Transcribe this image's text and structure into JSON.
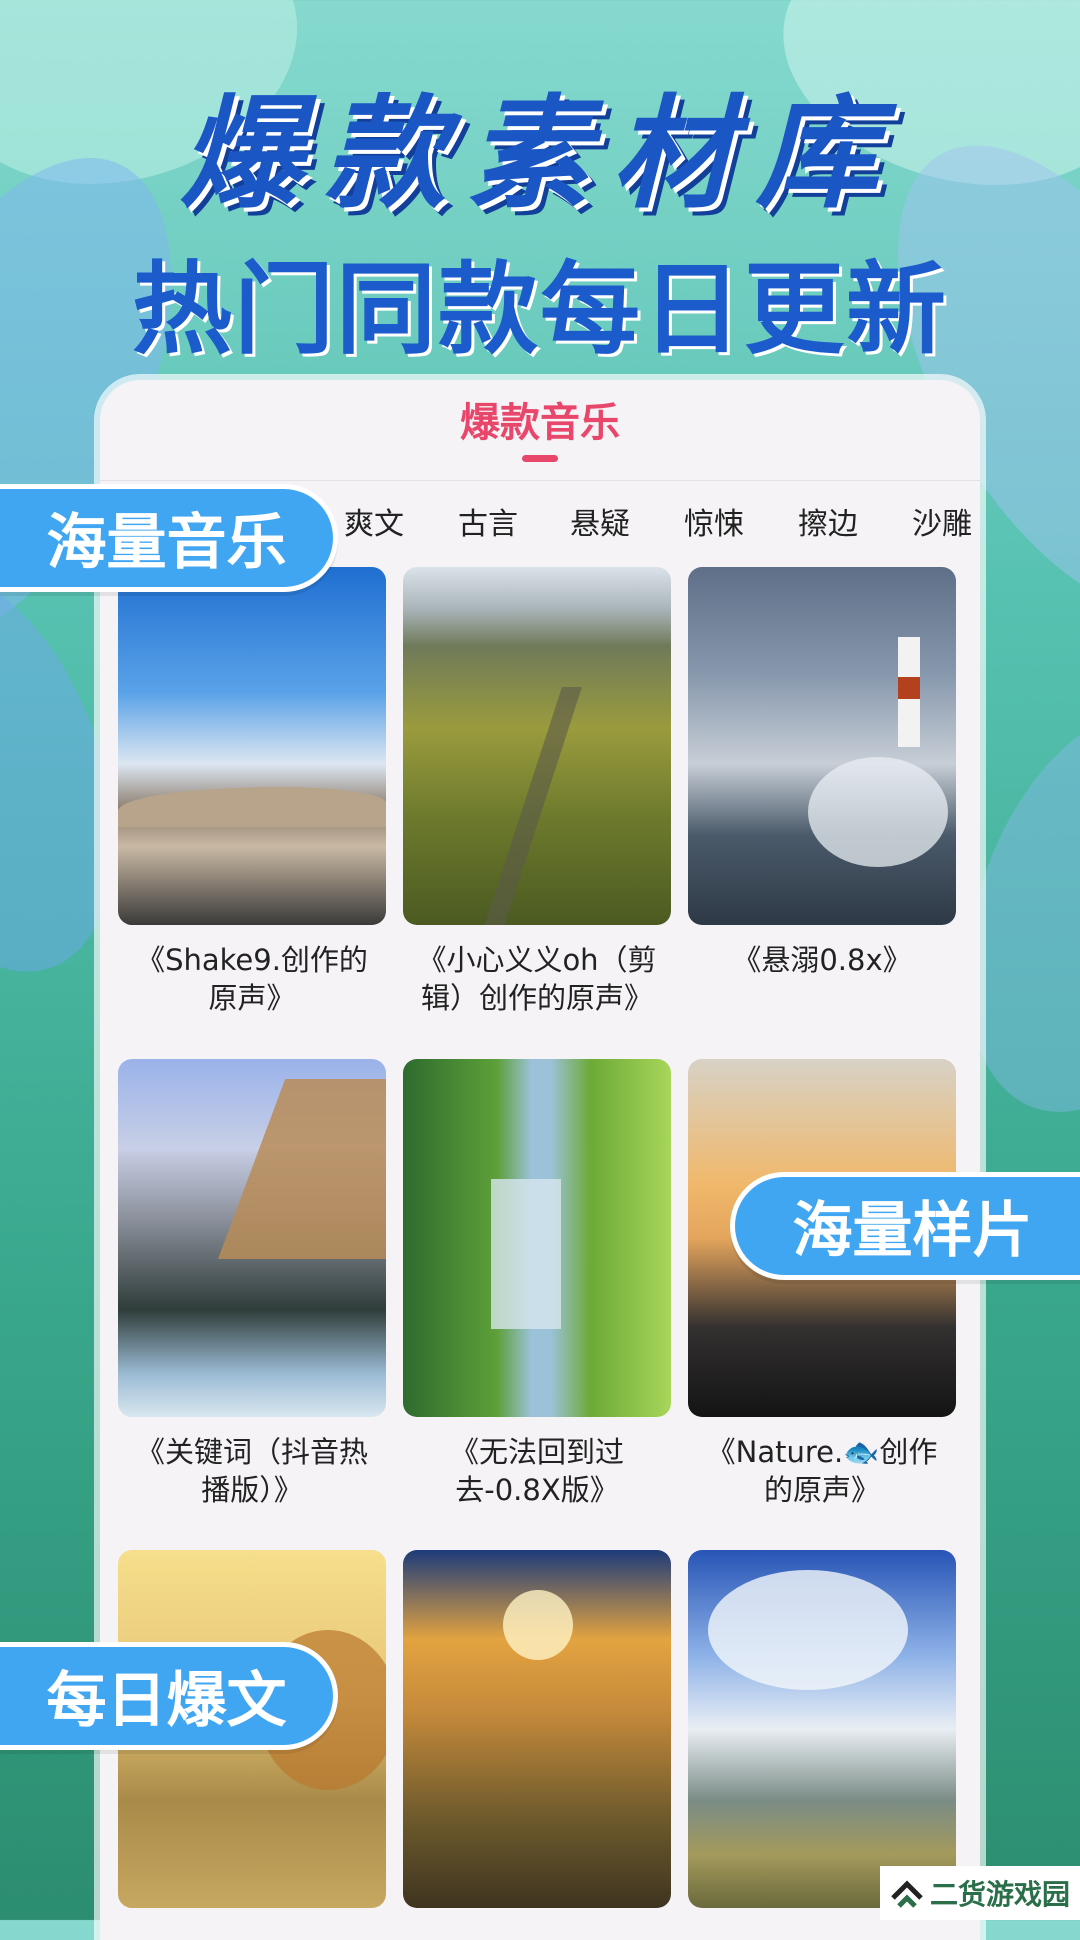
{
  "hero": {
    "title": "爆款素材库",
    "subtitle": "热门同款每日更新"
  },
  "phone": {
    "title": "爆款音乐",
    "tabs": [
      "爽文",
      "古言",
      "悬疑",
      "惊悚",
      "擦边",
      "沙雕"
    ],
    "cards": [
      {
        "caption_line1": "《Shake9.创作的",
        "caption_line2": "原声》"
      },
      {
        "caption_line1": "《小心义义oh（剪",
        "caption_line2": "辑）创作的原声》"
      },
      {
        "caption_line1": "《悬溺0.8x》",
        "caption_line2": ""
      },
      {
        "caption_line1": "《关键词（抖音热",
        "caption_line2": "播版）》"
      },
      {
        "caption_line1": "《无法回到过",
        "caption_line2": "去-0.8X版》"
      },
      {
        "caption_line1": "《Nature.🐟创作",
        "caption_line2": "的原声》"
      },
      {
        "caption_line1": "",
        "caption_line2": ""
      },
      {
        "caption_line1": "",
        "caption_line2": ""
      },
      {
        "caption_line1": "",
        "caption_line2": ""
      }
    ]
  },
  "badges": {
    "music": "海量音乐",
    "samples": "海量样片",
    "daily": "每日爆文"
  },
  "watermark": {
    "text": "二货游戏园"
  },
  "colors": {
    "accent": "#e8476b",
    "title_blue": "#1a56c4",
    "badge_blue": "#41a6f2"
  },
  "icons": {
    "watermark_logo": "double-chevron-logo-icon"
  }
}
